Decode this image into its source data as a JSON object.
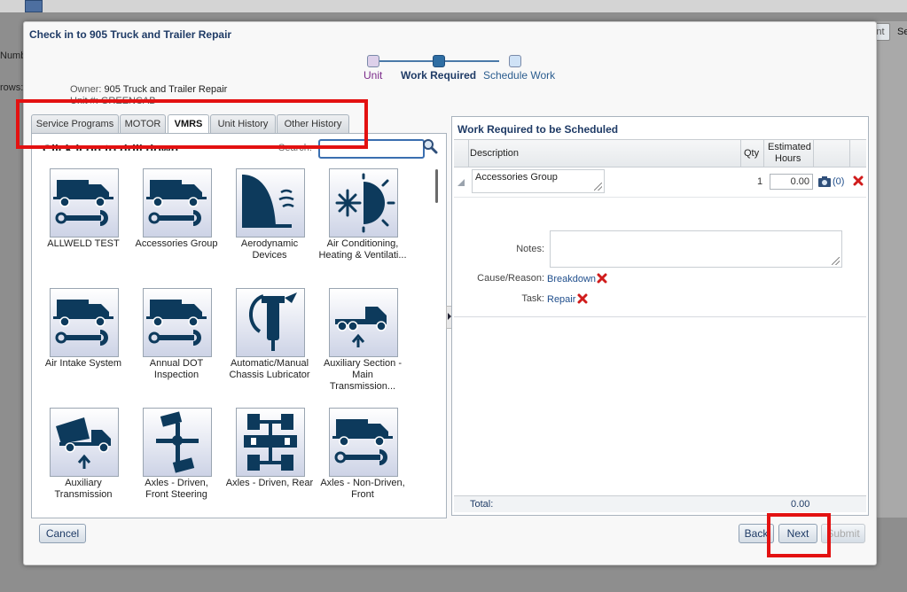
{
  "background": {
    "right_button_label": "nt",
    "right_text": "Se",
    "left_text_1": "Numbe",
    "left_text_2": "rows:"
  },
  "dialog": {
    "title": "Check in to 905 Truck and Trailer Repair"
  },
  "train": {
    "steps": [
      {
        "label": "Unit",
        "state": "visited"
      },
      {
        "label": "Work Required",
        "state": "current"
      },
      {
        "label": "Schedule Work",
        "state": "unvisited"
      }
    ]
  },
  "unit_info": {
    "owner_label": "Owner:",
    "owner_value": "905 Truck and Trailer Repair",
    "unit_label": "Unit #:",
    "unit_value": "GREENCAB"
  },
  "tabs": [
    {
      "label": "Service Programs",
      "active": false
    },
    {
      "label": "MOTOR",
      "active": false
    },
    {
      "label": "VMRS",
      "active": true
    },
    {
      "label": "Unit History",
      "active": false
    },
    {
      "label": "Other History",
      "active": false
    }
  ],
  "left_panel": {
    "heading": "Click icon to drill down",
    "search_label": "Search:",
    "search_value": "",
    "items": [
      {
        "label": "ALLWELD TEST",
        "icon": "truck-wrench-icon"
      },
      {
        "label": "Accessories Group",
        "icon": "truck-wrench-icon"
      },
      {
        "label": "Aerodynamic Devices",
        "icon": "aerodynamic-fairing-icon"
      },
      {
        "label": "Air Conditioning, Heating & Ventilati...",
        "icon": "snowflake-sun-icon"
      },
      {
        "label": "Air Intake System",
        "icon": "truck-wrench-icon"
      },
      {
        "label": "Annual DOT Inspection",
        "icon": "truck-wrench-icon"
      },
      {
        "label": "Automatic/Manual Chassis Lubricator",
        "icon": "grease-gun-icon"
      },
      {
        "label": "Auxiliary Section - Main Transmission...",
        "icon": "tractor-arrow-icon"
      },
      {
        "label": "Auxiliary Transmission",
        "icon": "dump-truck-arrow-icon"
      },
      {
        "label": "Axles - Driven, Front Steering",
        "icon": "axle-steering-icon"
      },
      {
        "label": "Axles - Driven, Rear",
        "icon": "axle-rear-icon"
      },
      {
        "label": "Axles - Non-Driven, Front",
        "icon": "truck-wrench-icon"
      }
    ]
  },
  "right_panel": {
    "title": "Work Required to be Scheduled",
    "columns": {
      "description": "Description",
      "qty": "Qty",
      "est_hours_1": "Estimated",
      "est_hours_2": "Hours"
    },
    "row": {
      "description": "Accessories Group",
      "qty": "1",
      "hours": "0.00",
      "attachments": "(0)"
    },
    "notes_label": "Notes:",
    "cause_label": "Cause/Reason:",
    "cause_value": "Breakdown",
    "task_label": "Task:",
    "task_value": "Repair",
    "total_label": "Total:",
    "total_value": "0.00"
  },
  "buttons": {
    "cancel": "Cancel",
    "back": "Back",
    "next": "Next",
    "submit": "Submit"
  },
  "colors": {
    "title": "#1f3b66",
    "icon_fill": "#0d3a5c",
    "highlight": "#e31111",
    "delete": "#d01c1c"
  }
}
